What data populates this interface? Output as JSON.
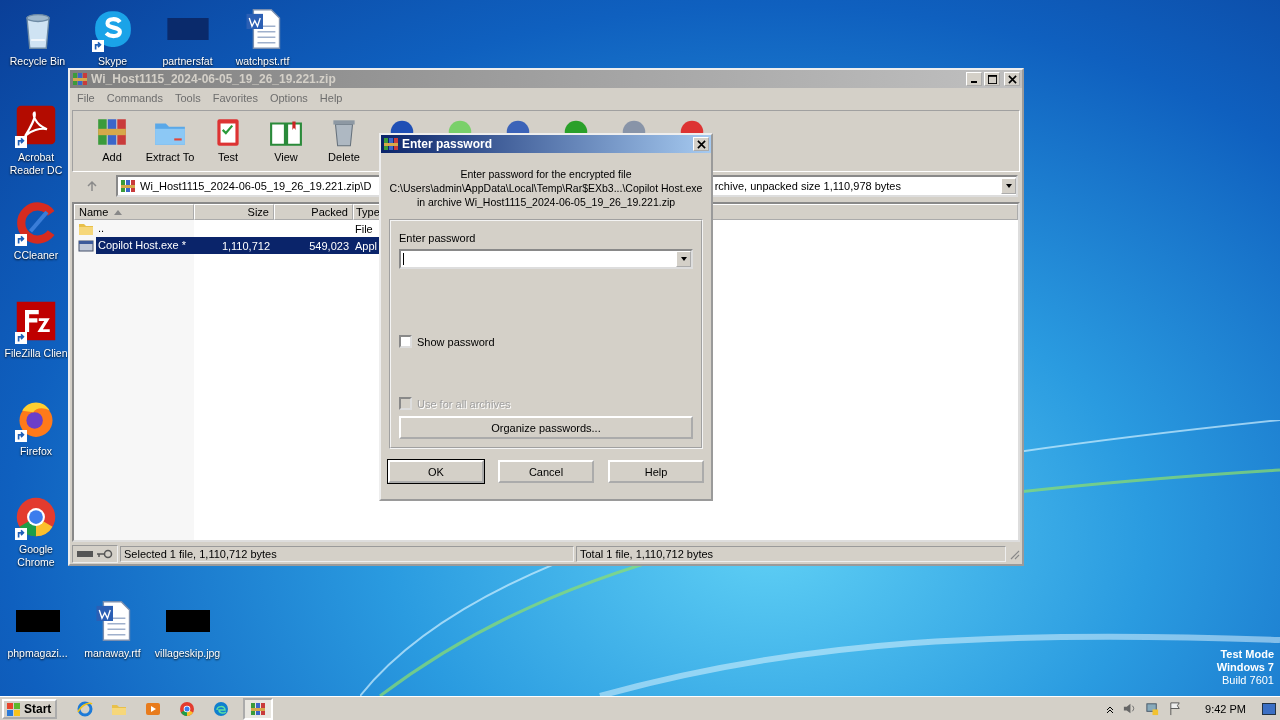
{
  "desktop": {
    "top_row": [
      {
        "label": "Recycle Bin",
        "kind": "recycle",
        "shortcut": false
      },
      {
        "label": "Skype",
        "kind": "skype",
        "shortcut": true
      },
      {
        "label": "partnersfat",
        "kind": "dark",
        "shortcut": false
      },
      {
        "label": "watchpst.rtf",
        "kind": "word",
        "shortcut": false
      }
    ],
    "left_column": [
      {
        "label": "Acrobat Reader DC",
        "kind": "acrobat",
        "shortcut": true
      },
      {
        "label": "CCleaner",
        "kind": "ccleaner",
        "shortcut": true
      },
      {
        "label": "FileZilla Clien",
        "kind": "filezilla",
        "shortcut": true
      },
      {
        "label": "Firefox",
        "kind": "firefox",
        "shortcut": true
      },
      {
        "label": "Google Chrome",
        "kind": "chrome",
        "shortcut": true
      }
    ],
    "bottom_row": [
      {
        "label": "phpmagazi...",
        "kind": "thumbnail",
        "shortcut": false
      },
      {
        "label": "manaway.rtf",
        "kind": "word",
        "shortcut": false
      },
      {
        "label": "villageskip.jpg",
        "kind": "thumbnail",
        "shortcut": false
      }
    ],
    "test_mode": [
      "Test Mode",
      "Windows 7",
      "Build 7601"
    ]
  },
  "archive_window": {
    "title": "Wi_Host1115_2024-06-05_19_26_19.221.zip",
    "active": false,
    "menu": [
      "File",
      "Commands",
      "Tools",
      "Favorites",
      "Options",
      "Help"
    ],
    "toolbar": [
      {
        "label": "Add",
        "kind": "add"
      },
      {
        "label": "Extract To",
        "kind": "extract"
      },
      {
        "label": "Test",
        "kind": "test"
      },
      {
        "label": "View",
        "kind": "view"
      },
      {
        "label": "Delete",
        "kind": "delete"
      }
    ],
    "address": {
      "text_start": "Wi_Host1115_2024-06-05_19_26_19.221.zip\\D",
      "text_end": "rchive, unpacked size 1,110,978 bytes"
    },
    "columns": [
      {
        "label": "Name",
        "sorted": true
      },
      {
        "label": "Size",
        "sorted": false
      },
      {
        "label": "Packed",
        "sorted": false
      },
      {
        "label": "Type",
        "sorted": false
      }
    ],
    "rows": [
      {
        "kind": "folder",
        "name": "..",
        "type": "File",
        "selected": false
      },
      {
        "kind": "exe",
        "name": "Copilot Host.exe *",
        "size": "1,110,712",
        "packed": "549,023",
        "type": "Appl",
        "selected": true
      }
    ],
    "status": [
      "Selected 1 file, 1,110,712 bytes",
      "Total 1 file, 1,110,712 bytes"
    ]
  },
  "dialog": {
    "title": "Enter password",
    "message": [
      "Enter password for the encrypted file",
      "C:\\Users\\admin\\AppData\\Local\\Temp\\Rar$EXb3...\\Copilot Host.exe",
      "in archive Wi_Host1115_2024-06-05_19_26_19.221.zip"
    ],
    "field_label": "Enter password",
    "options": [
      {
        "label": "Show password",
        "checked": false,
        "disabled": false
      },
      {
        "label": "Use for all archives",
        "checked": false,
        "disabled": true
      }
    ],
    "organize_button": "Organize passwords...",
    "buttons": [
      {
        "label": "OK",
        "default": true
      },
      {
        "label": "Cancel",
        "default": false
      },
      {
        "label": "Help",
        "default": false
      }
    ]
  },
  "taskbar": {
    "start": "Start",
    "items": [
      {
        "kind": "ie",
        "selected": false
      },
      {
        "kind": "explorer",
        "selected": false
      },
      {
        "kind": "media",
        "selected": false
      },
      {
        "kind": "chrome",
        "selected": false
      },
      {
        "kind": "edge",
        "selected": false
      },
      {
        "kind": "winrar",
        "selected": true
      }
    ],
    "clock": "9:42 PM"
  }
}
